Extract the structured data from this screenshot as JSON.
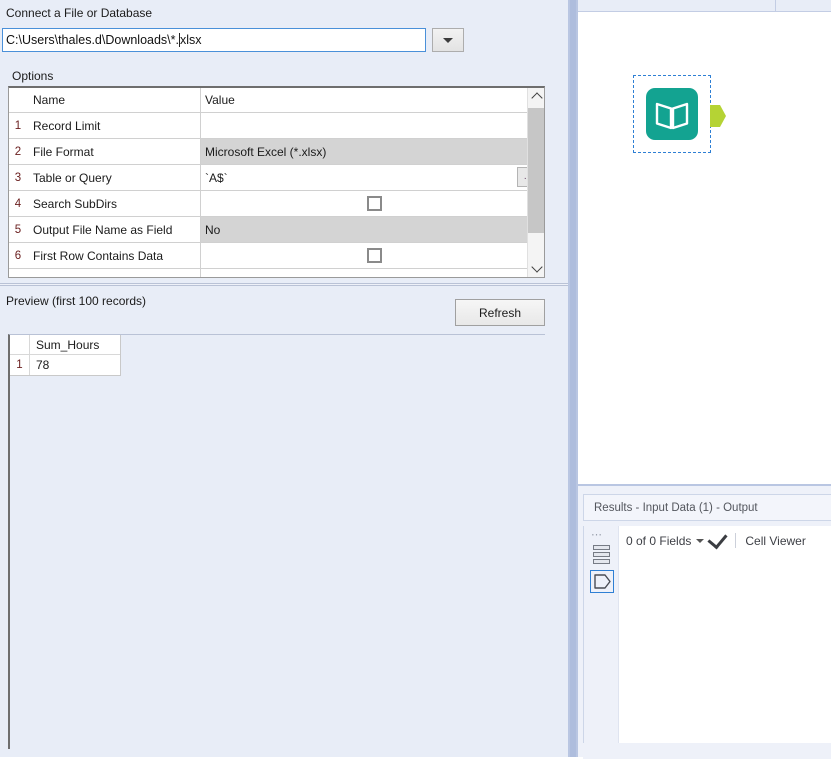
{
  "config": {
    "connect_label": "Connect a File or Database",
    "file_path": "C:\\Users\\thales.d\\Downloads\\*.",
    "file_path_tail": "xlsx",
    "dropdown_icon": "chevron-down-icon",
    "options_label": "Options",
    "options_grid": {
      "headers": {
        "num": "",
        "name": "Name",
        "value": "Value"
      },
      "rows": [
        {
          "num": "1",
          "name": "Record Limit",
          "value": "",
          "type": "text"
        },
        {
          "num": "2",
          "name": "File Format",
          "value": "Microsoft Excel (*.xlsx)",
          "type": "combo"
        },
        {
          "num": "3",
          "name": "Table or Query",
          "value": "`A$`",
          "type": "text-browse",
          "browse_label": "..."
        },
        {
          "num": "4",
          "name": "Search SubDirs",
          "value": "",
          "type": "checkbox",
          "checked": false
        },
        {
          "num": "5",
          "name": "Output File Name as Field",
          "value": "No",
          "type": "combo"
        },
        {
          "num": "6",
          "name": "First Row Contains Data",
          "value": "",
          "type": "checkbox",
          "checked": false
        }
      ]
    },
    "preview_label": "Preview (first 100 records)",
    "refresh_label": "Refresh",
    "preview_table": {
      "columns": [
        "Sum_Hours"
      ],
      "rows": [
        {
          "num": "1",
          "cells": [
            "78"
          ]
        }
      ]
    }
  },
  "canvas": {
    "tool_name": "input-data-tool",
    "tool_icon": "open-book-icon",
    "tool_color": "#13a391",
    "anchor_color": "#b5d334"
  },
  "results": {
    "tab_label": "Results - Input Data (1) - Output",
    "fields_label": "0 of 0 Fields",
    "fields_dropdown_icon": "caret-down-icon",
    "check_icon": "checkmark-icon",
    "cell_viewer_label": "Cell Viewer",
    "sidebar": {
      "overflow_icon": "overflow-dots-icon",
      "data_icon": "data-layers-icon",
      "metainfo_icon": "tag-pentagon-icon"
    }
  },
  "colors": {
    "panel_bg": "#e8edf7",
    "accent_blue": "#2e7fd4",
    "row_number": "#6b2020",
    "combo_row_bg": "#d4d4d4"
  }
}
